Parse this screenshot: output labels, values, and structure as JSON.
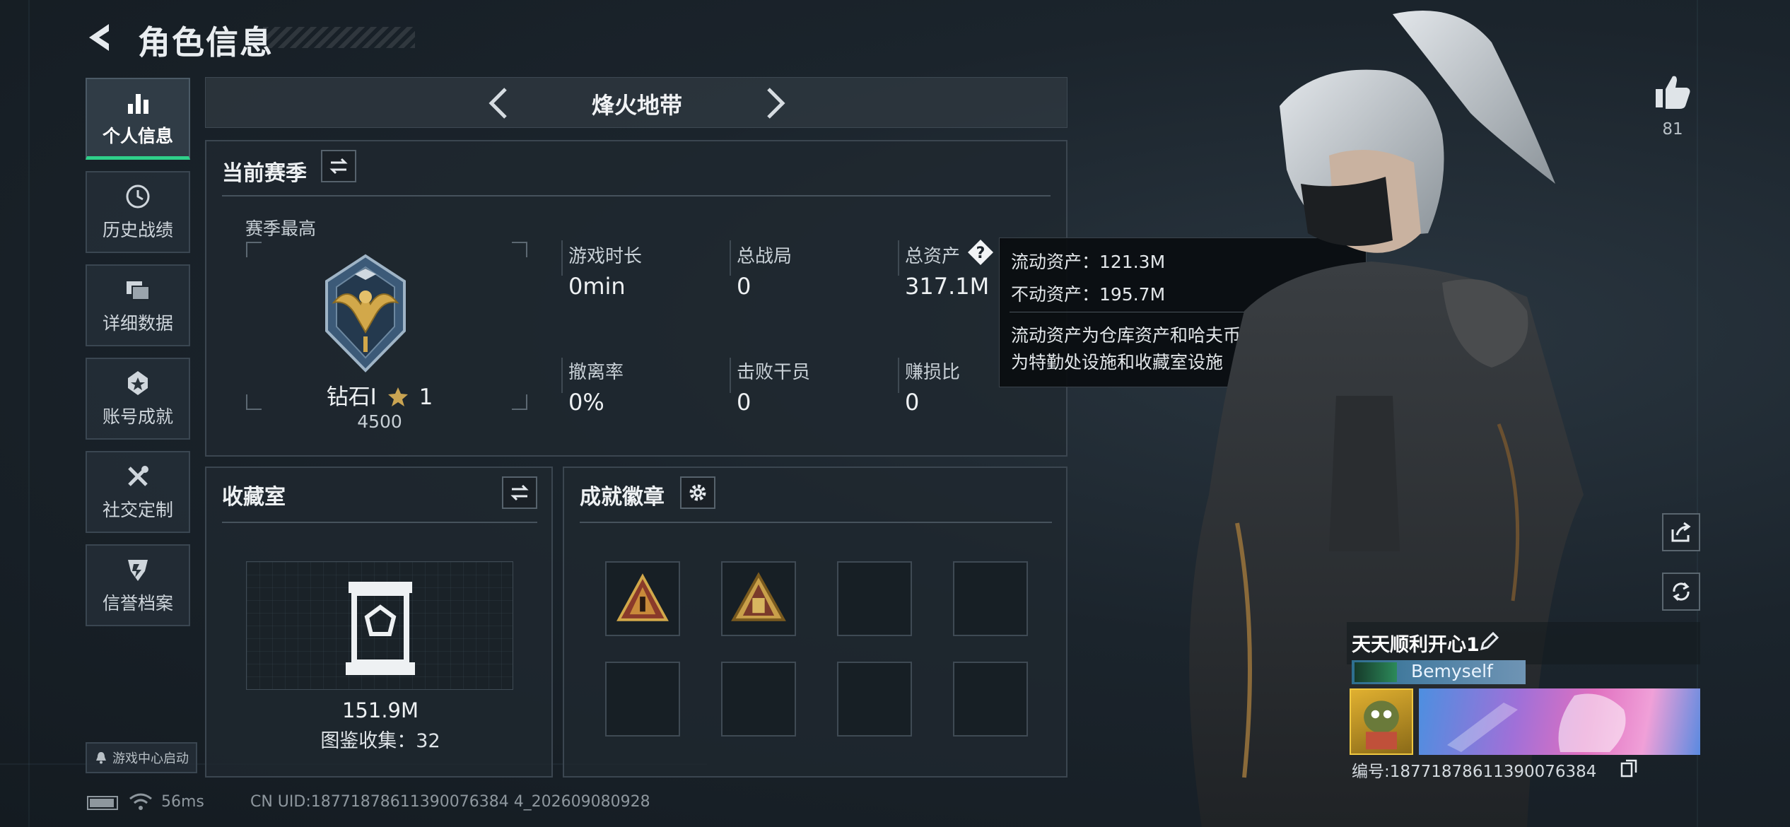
{
  "header": {
    "title": "角色信息"
  },
  "sidebar": {
    "items": [
      {
        "label": "个人信息",
        "icon": "bar-chart-icon",
        "active": true
      },
      {
        "label": "历史战绩",
        "icon": "history-clock-icon"
      },
      {
        "label": "详细数据",
        "icon": "cards-stack-icon"
      },
      {
        "label": "账号成就",
        "icon": "achievement-medal-icon"
      },
      {
        "label": "社交定制",
        "icon": "tools-wrench-icon"
      },
      {
        "label": "信誉档案",
        "icon": "shield-emblem-icon"
      }
    ],
    "launch_label": "游戏中心启动"
  },
  "mode": {
    "title": "烽火地带"
  },
  "season": {
    "title": "当前赛季",
    "best_label": "赛季最高",
    "rank_name": "钻石I",
    "rank_stars": "1",
    "rank_points": "4500",
    "stats": [
      {
        "label": "游戏时长",
        "value": "0min"
      },
      {
        "label": "总战局",
        "value": "0"
      },
      {
        "label": "总资产",
        "value": "317.1M"
      },
      {
        "label": "撤离率",
        "value": "0%"
      },
      {
        "label": "击败干员",
        "value": "0"
      },
      {
        "label": "赚损比",
        "value": "0"
      }
    ]
  },
  "tooltip": {
    "liquid": "流动资产：121.3M",
    "fixed": "不动资产：195.7M",
    "desc_line1": "流动资产为仓库资产和哈夫币，不动资产",
    "desc_line2": "为特勤处设施和收藏室设施"
  },
  "collection": {
    "title": "收藏室",
    "value": "151.9M",
    "count_text": "图鉴收集：32"
  },
  "badges": {
    "title": "成就徽章",
    "slots": [
      {
        "filled": true,
        "icon": "triangle-badge-icon"
      },
      {
        "filled": true,
        "icon": "triangle-badge-icon"
      },
      {
        "filled": false
      },
      {
        "filled": false
      },
      {
        "filled": false
      },
      {
        "filled": false
      },
      {
        "filled": false
      },
      {
        "filled": false
      }
    ]
  },
  "player": {
    "likes": "81",
    "name": "天天顺利开心1",
    "title_badge": "Bemyself",
    "id_text": "编号:18771878611390076384"
  },
  "status_bar": {
    "ping": "56ms",
    "uid": "CN UID:18771878611390076384 4_202609080928"
  },
  "colors": {
    "accent": "#2fd08a",
    "panel": "#1f2830",
    "border": "#3b4650"
  }
}
